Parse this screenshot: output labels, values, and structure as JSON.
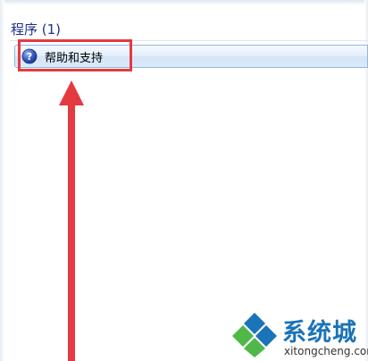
{
  "search_results": {
    "group_header": "程序 (1)",
    "items": [
      {
        "label": "帮助和支持",
        "icon": "help-question-icon"
      }
    ]
  },
  "annotation": {
    "highlight_color": "#e53a40",
    "arrow_color": "#e53a40"
  },
  "watermark": {
    "brand": "系统城",
    "url": "xitongcheng.com",
    "colors": {
      "blue": "#1b73b8",
      "green": "#4fb848"
    }
  }
}
